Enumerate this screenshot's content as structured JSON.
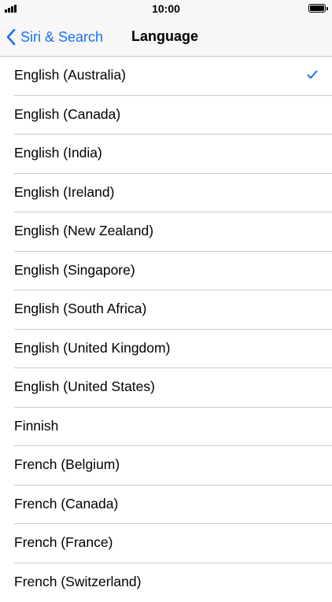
{
  "status_bar": {
    "time": "10:00",
    "signal_icon": "cellular-signal-icon",
    "battery_icon": "battery-icon"
  },
  "nav": {
    "back_label": "Siri & Search",
    "back_icon": "chevron-left-icon",
    "title": "Language"
  },
  "colors": {
    "accent": "#1a6ff4",
    "separator": "#c8c7cc",
    "bar_background": "#f7f7f7"
  },
  "languages": [
    {
      "label": "English (Australia)",
      "selected": true
    },
    {
      "label": "English (Canada)",
      "selected": false
    },
    {
      "label": "English (India)",
      "selected": false
    },
    {
      "label": "English (Ireland)",
      "selected": false
    },
    {
      "label": "English (New Zealand)",
      "selected": false
    },
    {
      "label": "English (Singapore)",
      "selected": false
    },
    {
      "label": "English (South Africa)",
      "selected": false
    },
    {
      "label": "English (United Kingdom)",
      "selected": false
    },
    {
      "label": "English (United States)",
      "selected": false
    },
    {
      "label": "Finnish",
      "selected": false
    },
    {
      "label": "French (Belgium)",
      "selected": false
    },
    {
      "label": "French (Canada)",
      "selected": false
    },
    {
      "label": "French (France)",
      "selected": false
    },
    {
      "label": "French (Switzerland)",
      "selected": false
    }
  ]
}
